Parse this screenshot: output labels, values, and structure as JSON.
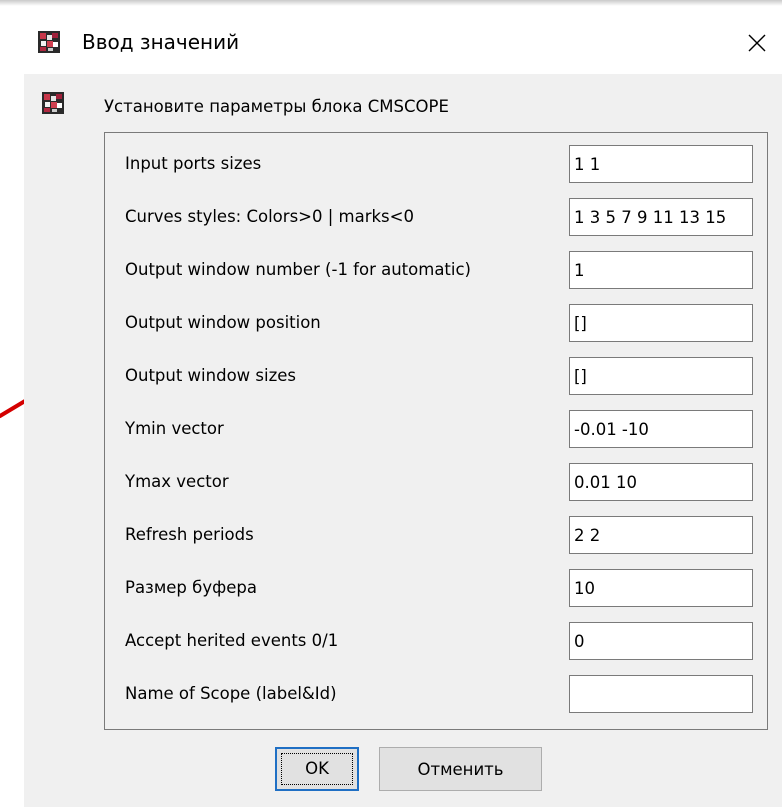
{
  "window": {
    "title": "Ввод значений",
    "icon": "scilab-app-icon",
    "close_icon": "close-icon"
  },
  "dialog": {
    "prompt": "Установите параметры блока CMSCOPE",
    "fields": [
      {
        "label": "Input ports sizes",
        "value": "1 1"
      },
      {
        "label": "Curves styles: Colors>0 | marks<0",
        "value": "1 3 5 7 9 11 13 15"
      },
      {
        "label": "Output window number (-1 for automatic)",
        "value": "1"
      },
      {
        "label": "Output window position",
        "value": "[]"
      },
      {
        "label": "Output window sizes",
        "value": "[]"
      },
      {
        "label": "Ymin vector",
        "value": "-0.01 -10"
      },
      {
        "label": "Ymax vector",
        "value": "0.01 10"
      },
      {
        "label": "Refresh periods",
        "value": "2 2"
      },
      {
        "label": "Размер буфера",
        "value": "10"
      },
      {
        "label": "Accept herited events 0/1",
        "value": "0"
      },
      {
        "label": "Name of Scope (label&Id)",
        "value": ""
      }
    ],
    "ok_label": "OK",
    "cancel_label": "Отменить"
  },
  "colors": {
    "dialog_background": "#f0f0f0",
    "focus_border": "#1f6fc4",
    "button_face": "#e1e1e1",
    "annotation_arrow": "#d40000"
  }
}
